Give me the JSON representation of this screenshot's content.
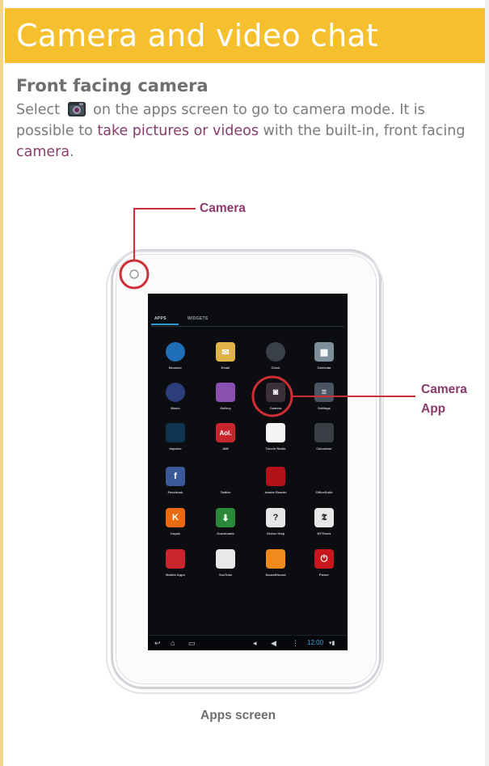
{
  "header": {
    "title": "Camera and video chat"
  },
  "section": {
    "title": "Front facing camera",
    "text_before_icon": "Select",
    "text_after_icon": "on the apps screen to go to camera mode. It is possible to",
    "text_link1": "take pictures or videos",
    "text_middle": "with the built-in, front facing",
    "text_link2": "camera",
    "text_end": "."
  },
  "callouts": {
    "camera": "Camera",
    "camera_app_line1": "Camera",
    "camera_app_line2": "App"
  },
  "caption": "Apps screen",
  "tablet": {
    "tabs": {
      "apps": "APPS",
      "widgets": "WIDGETS"
    },
    "apps": [
      {
        "label": "Browser",
        "icon": "browser-icon",
        "color": "#1f6fb8",
        "glyph": ""
      },
      {
        "label": "Email",
        "icon": "email-icon",
        "color": "#e0b24a",
        "glyph": "✉"
      },
      {
        "label": "Clock",
        "icon": "clock-icon",
        "color": "#3a4049",
        "glyph": ""
      },
      {
        "label": "Calendar",
        "icon": "calendar-icon",
        "color": "#7c8f9a",
        "glyph": "▦"
      },
      {
        "label": "Music",
        "icon": "music-icon",
        "color": "#2b3d7a",
        "glyph": ""
      },
      {
        "label": "Gallery",
        "icon": "gallery-icon",
        "color": "#8b4fb0",
        "glyph": ""
      },
      {
        "label": "Camera",
        "icon": "camera-icon",
        "color": "#3b2f3a",
        "glyph": "◙"
      },
      {
        "label": "Settings",
        "icon": "settings-icon",
        "color": "#4a5563",
        "glyph": "≡"
      },
      {
        "label": "Impulse",
        "icon": "impulse-icon",
        "color": "#0e3550",
        "glyph": ""
      },
      {
        "label": "AIM",
        "icon": "aol-icon",
        "color": "#c8262c",
        "glyph": "Aol."
      },
      {
        "label": "TuneIn Radio",
        "icon": "tunein-radio-icon",
        "color": "#f4f4f4",
        "glyph": ""
      },
      {
        "label": "Calculator",
        "icon": "calculator-icon",
        "color": "#3a3f46",
        "glyph": ""
      },
      {
        "label": "Facebook",
        "icon": "facebook-icon",
        "color": "#3b5998",
        "glyph": "f"
      },
      {
        "label": "Twitter",
        "icon": "twitter-icon",
        "color": "#0b0d10",
        "glyph": ""
      },
      {
        "label": "Adobe Reader",
        "icon": "adobe-reader-icon",
        "color": "#b3121b",
        "glyph": ""
      },
      {
        "label": "OfficeSuite",
        "icon": "officesuite-icon",
        "color": "#0b0d10",
        "glyph": ""
      },
      {
        "label": "Kayak",
        "icon": "kayak-icon",
        "color": "#e86a12",
        "glyph": "K"
      },
      {
        "label": "Downloads",
        "icon": "downloads-icon",
        "color": "#2a8a3a",
        "glyph": "⬇"
      },
      {
        "label": "Online Help",
        "icon": "online-help-icon",
        "color": "#e6e6e6",
        "glyph": "?"
      },
      {
        "label": "NYTimes",
        "icon": "nytimes-icon",
        "color": "#e8e8e8",
        "glyph": "𝕿"
      },
      {
        "label": "Mobile Apps",
        "icon": "mobile-apps-icon",
        "color": "#c8262c",
        "glyph": ""
      },
      {
        "label": "YouTube",
        "icon": "youtube-icon",
        "color": "#e8e8e8",
        "glyph": ""
      },
      {
        "label": "SoundHound",
        "icon": "soundhound-icon",
        "color": "#f08a1c",
        "glyph": ""
      },
      {
        "label": "Power",
        "icon": "power-icon",
        "color": "#c8161d",
        "glyph": "⏻"
      }
    ],
    "status_time": "12:00"
  }
}
